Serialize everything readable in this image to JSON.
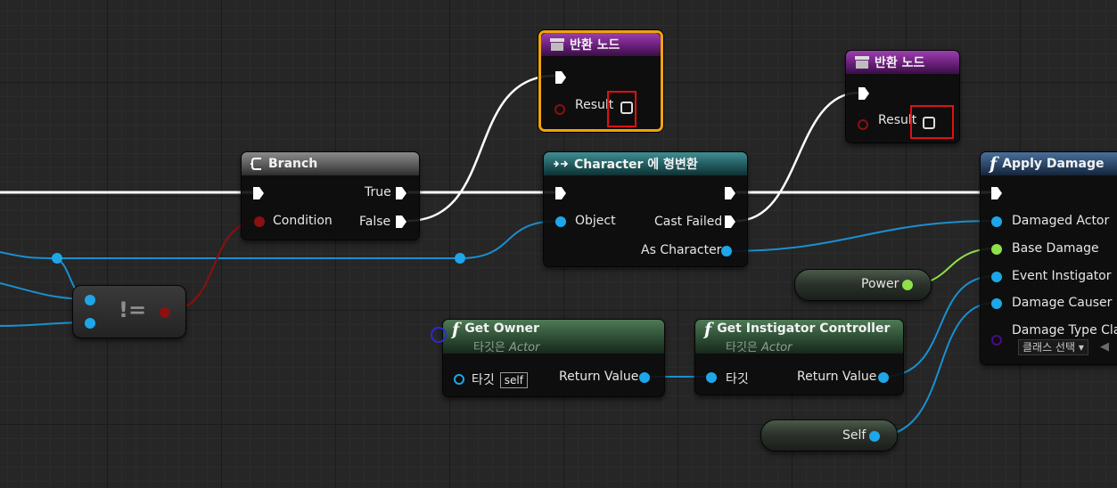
{
  "colors": {
    "exec": "#ffffff",
    "object": "#1ea6e8",
    "boolean": "#8c1010",
    "float": "#8fe04a",
    "class": "#4a0a8a",
    "selected_border": "#f0a30a",
    "highlight_box": "#e01010"
  },
  "return_node_1": {
    "title": "반환 노드",
    "icon": "return-node-icon",
    "result_label": "Result"
  },
  "return_node_2": {
    "title": "반환 노드",
    "icon": "return-node-icon",
    "result_label": "Result"
  },
  "branch": {
    "title": "Branch",
    "icon": "branch-icon",
    "true_label": "True",
    "false_label": "False",
    "condition_label": "Condition"
  },
  "cast": {
    "title": "Character 에 형변환",
    "icon": "cast-icon",
    "object_label": "Object",
    "cast_failed_label": "Cast Failed",
    "as_character_label": "As Character"
  },
  "apply_damage": {
    "title": "Apply Damage",
    "icon": "function-icon",
    "pins": [
      "Damaged Actor",
      "Base Damage",
      "Event Instigator",
      "Damage Causer",
      "Damage Type Clas"
    ],
    "class_dropdown": "클래스 선택"
  },
  "not_equal": {
    "symbol": "!="
  },
  "power": {
    "label": "Power"
  },
  "self_node": {
    "label": "Self"
  },
  "get_owner": {
    "title": "Get Owner",
    "subtitle_prefix": "타깃은",
    "subtitle_type": "Actor",
    "target_label": "타깃",
    "self_label": "self",
    "return_label": "Return Value"
  },
  "get_instigator": {
    "title": "Get Instigator Controller",
    "subtitle_prefix": "타깃은",
    "subtitle_type": "Actor",
    "target_label": "타깃",
    "return_label": "Return Value"
  }
}
